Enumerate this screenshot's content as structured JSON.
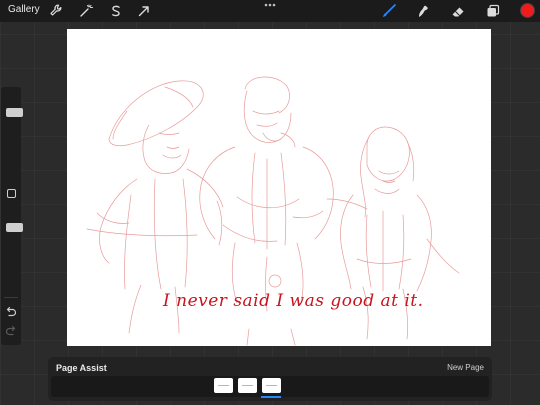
{
  "topbar": {
    "gallery_label": "Gallery",
    "tools_left": [
      "wrench-icon",
      "magic-wand-icon",
      "selection-s-icon",
      "transform-arrow-icon"
    ],
    "tools_right": [
      "brush-icon",
      "smudge-icon",
      "eraser-icon",
      "layers-icon"
    ],
    "active_tool": "brush-icon",
    "active_color": "#ee1c1c",
    "accent_color": "#2a86ff"
  },
  "sidebar": {
    "brush_size_level": 0.82,
    "opacity_level": 0.74,
    "controls": [
      "modify-square-icon",
      "undo-icon",
      "redo-icon"
    ]
  },
  "canvas": {
    "caption": "I never said I was good at it."
  },
  "page_assist": {
    "title": "Page Assist",
    "new_page_label": "New Page",
    "page_count": 3,
    "active_page": 3
  }
}
